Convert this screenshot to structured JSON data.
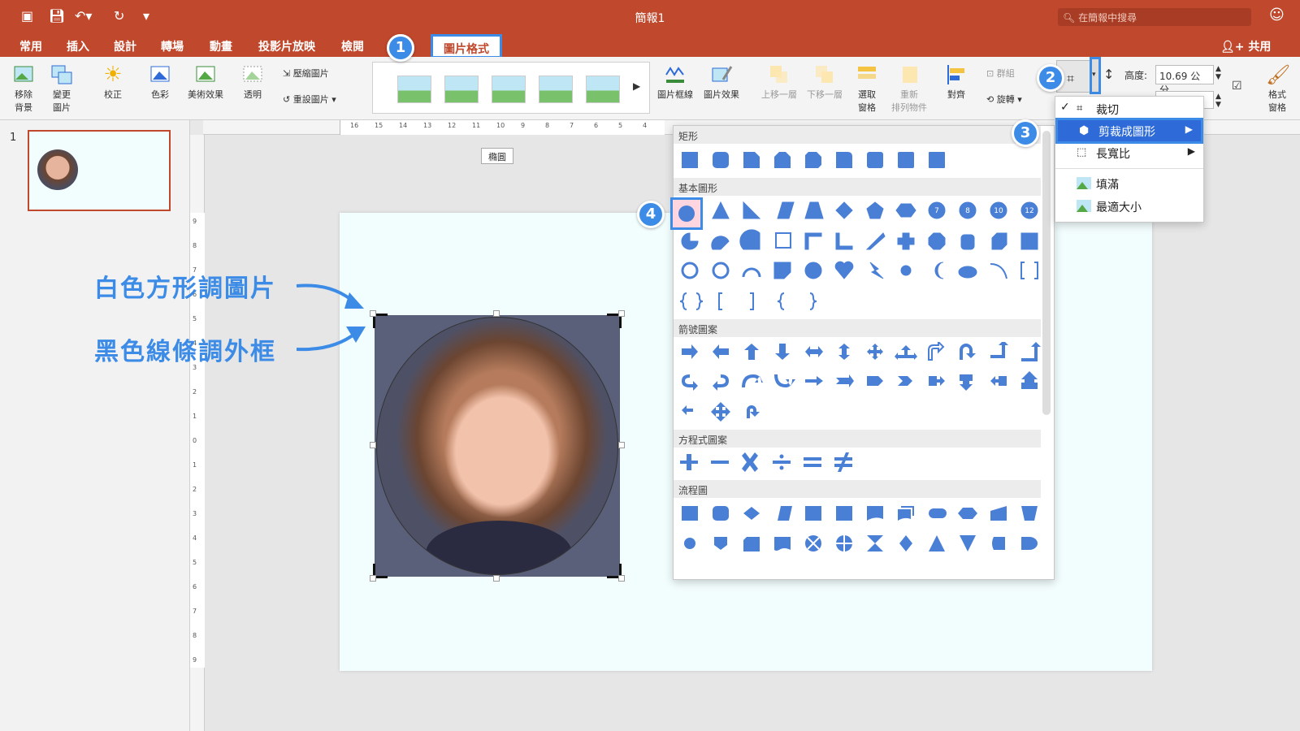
{
  "title_bar": {
    "doc_title": "簡報1",
    "search_placeholder": "在簡報中搜尋"
  },
  "tabs": [
    {
      "label": "常用"
    },
    {
      "label": "插入"
    },
    {
      "label": "設計"
    },
    {
      "label": "轉場"
    },
    {
      "label": "動畫"
    },
    {
      "label": "投影片放映"
    },
    {
      "label": "檢閱"
    },
    {
      "label": "圖片格式"
    }
  ],
  "share_label": "共用",
  "ribbon": {
    "remove_bg": "移除\n背景",
    "change_pic": "變更\n圖片",
    "corrections": "校正",
    "color": "色彩",
    "artistic": "美術效果",
    "transparency": "透明",
    "compress": "壓縮圖片",
    "reset": "重設圖片",
    "pic_border": "圖片框線",
    "pic_effects": "圖片效果",
    "bring_forward": "上移一層",
    "send_backward": "下移一層",
    "selection_pane": "選取\n窗格",
    "reorder": "重新\n排列物件",
    "align": "對齊",
    "group": "群組",
    "rotate": "旋轉",
    "height_label": "高度:",
    "height_value": "10.69 公分",
    "format_pane": "格式\n窗格"
  },
  "tooltip": "橢圓",
  "slide_number": "1",
  "annotations": {
    "line1": "白色方形調圖片",
    "line2": "黑色線條調外框",
    "badges": [
      "1",
      "2",
      "3",
      "4"
    ]
  },
  "shapes_panel": {
    "sections": [
      "矩形",
      "基本圖形",
      "箭號圖案",
      "方程式圖案",
      "流程圖"
    ],
    "number_shapes": [
      "7",
      "8",
      "10",
      "12"
    ]
  },
  "crop_menu": {
    "items": [
      {
        "label": "裁切",
        "checked": true
      },
      {
        "label": "剪裁成圖形",
        "submenu": true
      },
      {
        "label": "長寬比",
        "submenu": true
      },
      {
        "label": "填滿"
      },
      {
        "label": "最適大小"
      }
    ]
  },
  "ruler_top": [
    "16",
    "15",
    "14",
    "13",
    "12",
    "11",
    "10",
    "9",
    "8",
    "7",
    "6",
    "5",
    "4"
  ],
  "ruler_left": [
    "9",
    "8",
    "7",
    "6",
    "5",
    "4",
    "3",
    "2",
    "1",
    "0",
    "1",
    "2",
    "3",
    "4",
    "5",
    "6",
    "7",
    "8",
    "9"
  ],
  "colors": {
    "accent": "#c0482c",
    "annotation": "#3c8ce7",
    "shape": "#4a7fd6"
  }
}
